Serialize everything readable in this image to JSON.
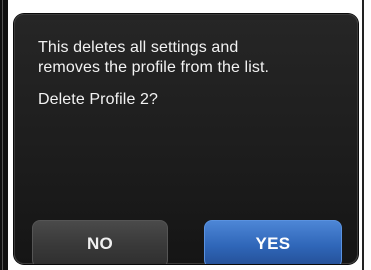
{
  "dialog": {
    "message_line_1": "This deletes all settings and",
    "message_line_2": "removes the profile from the list.",
    "question": "Delete Profile 2?"
  },
  "buttons": {
    "no_label": "NO",
    "yes_label": "YES"
  },
  "colors": {
    "dialog_background": "#1d1d1d",
    "text": "#f2f2f2",
    "no_button": "#3a3a3a",
    "yes_button": "#2f66b8"
  }
}
